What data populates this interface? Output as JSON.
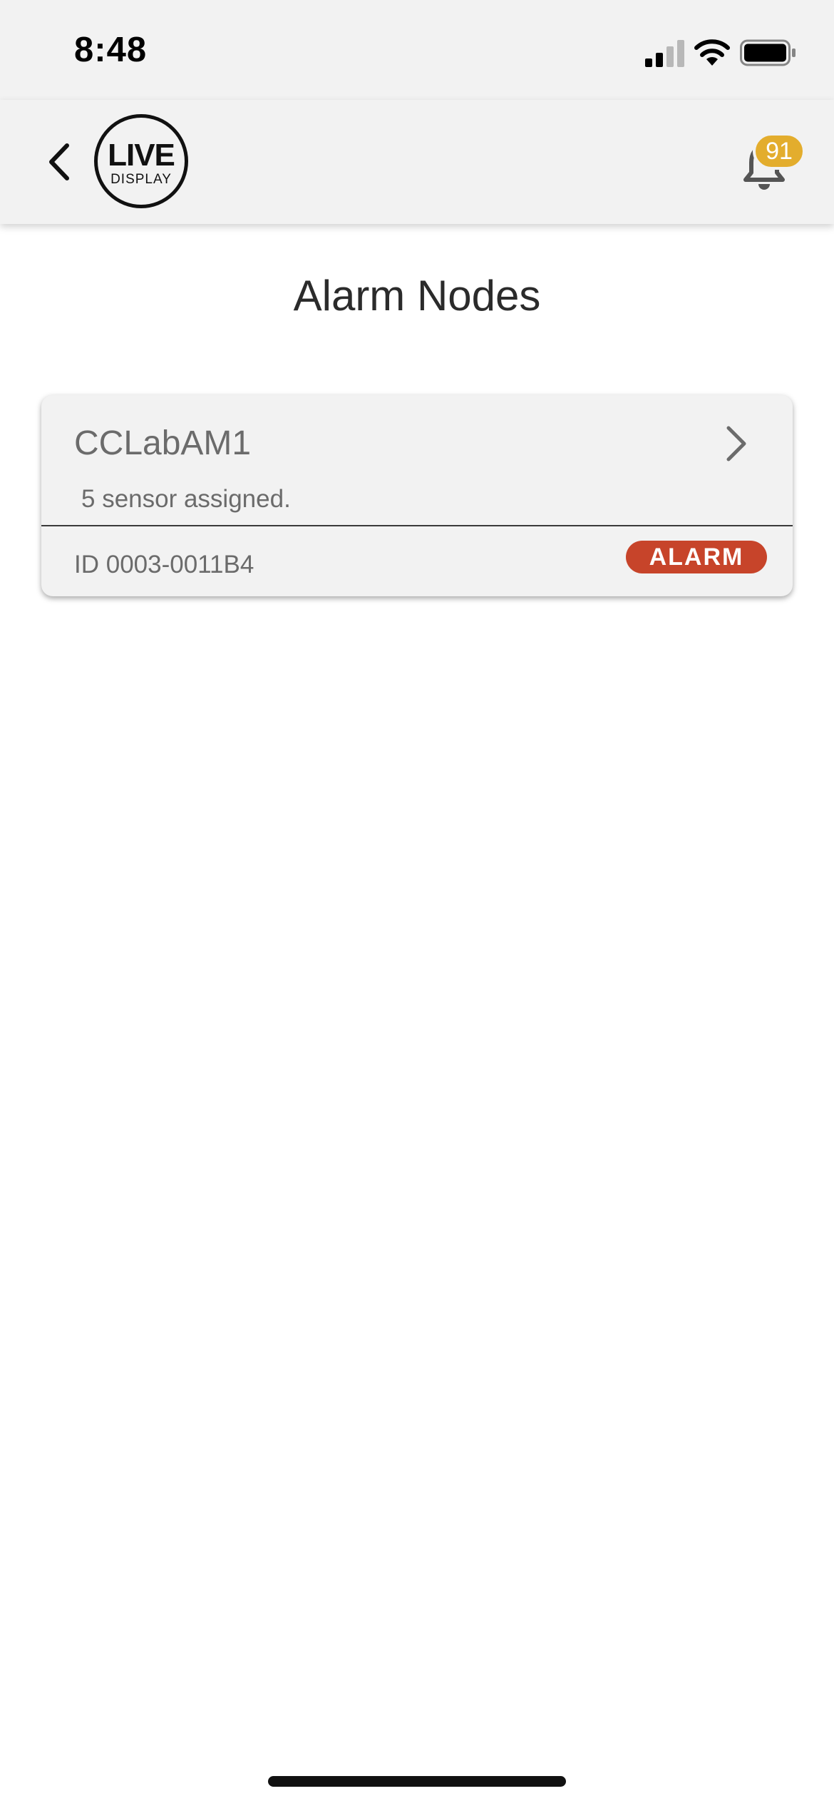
{
  "status_bar": {
    "time": "8:48"
  },
  "nav": {
    "logo": {
      "line1": "LIVE",
      "line2": "DISPLAY"
    },
    "notification_count": "91"
  },
  "page": {
    "title": "Alarm Nodes"
  },
  "nodes": [
    {
      "name": "CCLabAM1",
      "sensors": "5 sensor assigned.",
      "id": "ID 0003-0011B4",
      "status": "ALARM"
    }
  ],
  "colors": {
    "alarm_badge": "#c7442a",
    "notification_badge": "#e3ad2d",
    "header_background": "#f2f2f2"
  },
  "icons": {
    "back": "chevron-left-icon",
    "notifications": "bell-icon",
    "open_node": "chevron-right-icon"
  }
}
